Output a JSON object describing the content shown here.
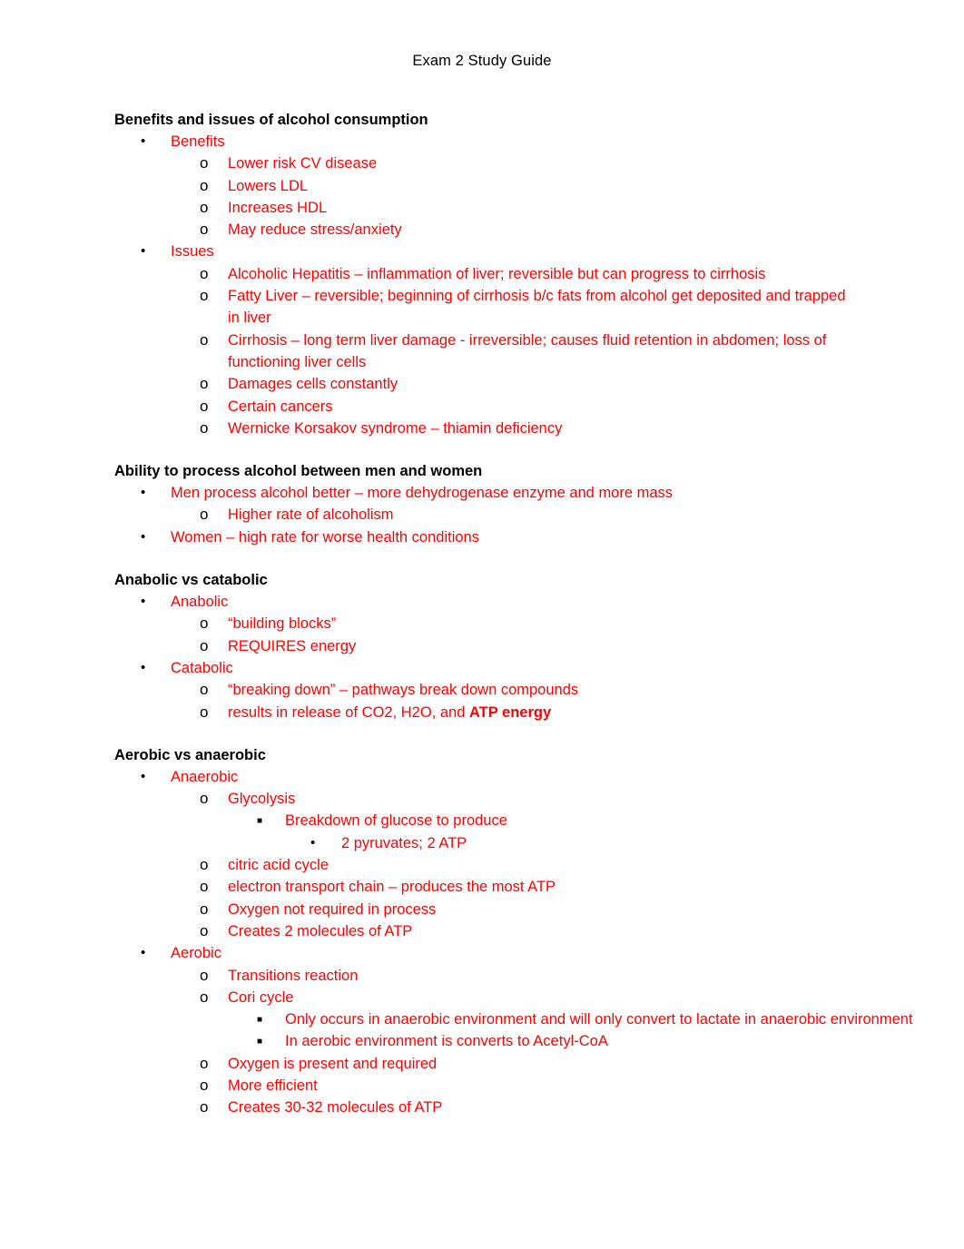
{
  "document": {
    "title": "Exam 2 Study Guide",
    "colors": {
      "heading": "#000000",
      "notes": "#ff0000"
    },
    "markers": {
      "level1": "•",
      "level2": "o",
      "level3": "■",
      "level4": "•"
    }
  },
  "sections": [
    {
      "heading": "Benefits and issues of alcohol consumption",
      "items": [
        {
          "text": "Benefits",
          "children": [
            "Lower risk CV disease",
            "Lowers LDL",
            "Increases HDL",
            "May reduce stress/anxiety"
          ]
        },
        {
          "text": "Issues",
          "children": [
            "Alcoholic Hepatitis – inflammation of liver; reversible but can progress to cirrhosis",
            "Fatty Liver – reversible; beginning of cirrhosis b/c fats from alcohol get deposited and trapped in liver",
            "Cirrhosis – long term liver damage - irreversible; causes fluid retention in abdomen; loss of functioning liver cells",
            "Damages cells constantly",
            "Certain cancers",
            "Wernicke Korsakov syndrome – thiamin deficiency"
          ]
        }
      ]
    },
    {
      "heading": "Ability to process alcohol between men and women",
      "items": [
        {
          "text": "Men process alcohol better – more dehydrogenase enzyme and more mass",
          "children": [
            "Higher rate of alcoholism"
          ]
        },
        {
          "text": "Women – high rate for worse health conditions",
          "children": []
        }
      ]
    },
    {
      "heading": "Anabolic vs catabolic",
      "items": [
        {
          "text": "Anabolic",
          "children": [
            "“building blocks”",
            "REQUIRES energy"
          ]
        },
        {
          "text": "Catabolic",
          "children": [
            "“breaking down” – pathways break down compounds",
            {
              "prefix": "results in release of CO2, H2O, and ",
              "bold": "ATP energy"
            }
          ]
        }
      ]
    },
    {
      "heading": "Aerobic vs anaerobic",
      "items": [
        {
          "text": "Anaerobic",
          "children": [
            {
              "text": "Glycolysis",
              "children": [
                {
                  "text": "Breakdown of glucose to produce",
                  "children": [
                    "2 pyruvates; 2 ATP"
                  ]
                }
              ]
            },
            "citric acid cycle",
            "electron transport chain – produces the most ATP",
            "Oxygen not required in process",
            "Creates 2 molecules of ATP"
          ]
        },
        {
          "text": "Aerobic",
          "children": [
            "Transitions reaction",
            {
              "text": "Cori cycle",
              "children": [
                "Only occurs in anaerobic environment and will only convert to lactate in anaerobic environment",
                "In aerobic environment is converts to Acetyl-CoA"
              ]
            },
            "Oxygen is present and required",
            "More efficient",
            "Creates 30-32 molecules of ATP"
          ]
        }
      ]
    }
  ]
}
